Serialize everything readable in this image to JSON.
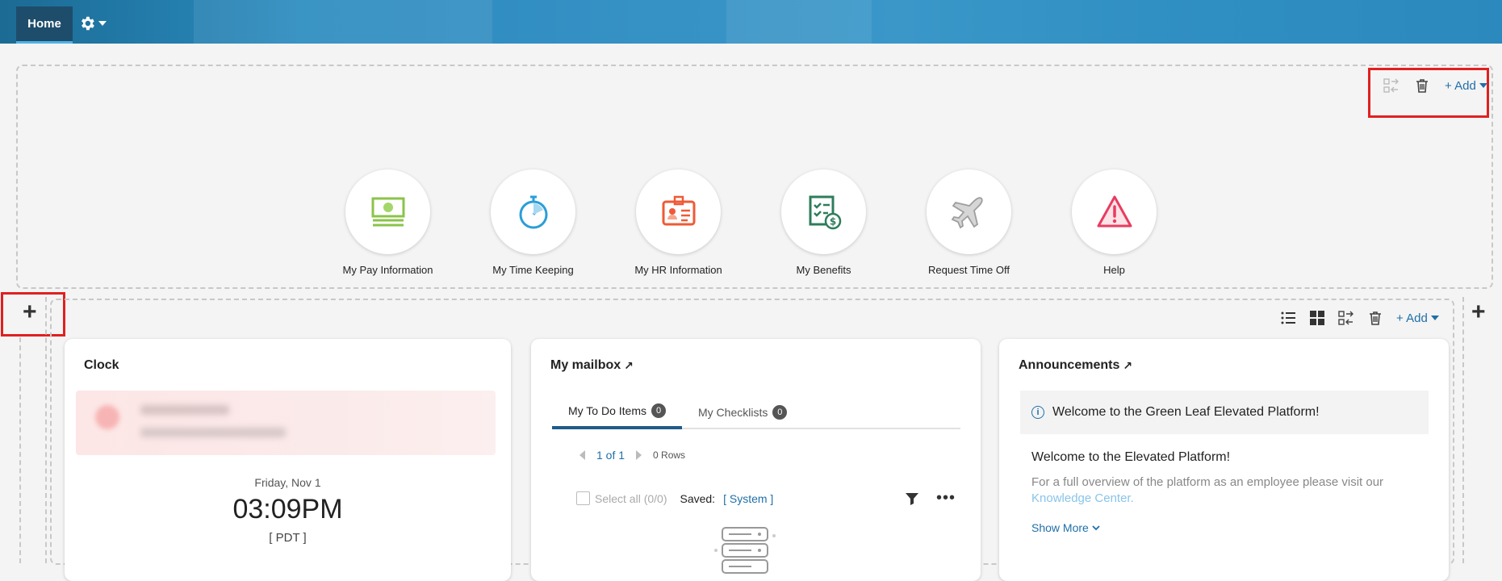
{
  "nav": {
    "home_tab": "Home"
  },
  "top_toolbar": {
    "add_label": "+ Add"
  },
  "quick_links": [
    {
      "label": "My Pay Information",
      "icon": "pay-icon"
    },
    {
      "label": "My Time Keeping",
      "icon": "stopwatch-icon"
    },
    {
      "label": "My HR Information",
      "icon": "id-badge-icon"
    },
    {
      "label": "My Benefits",
      "icon": "benefits-icon"
    },
    {
      "label": "Request Time Off",
      "icon": "airplane-icon"
    },
    {
      "label": "Help",
      "icon": "warning-icon"
    }
  ],
  "bottom_toolbar": {
    "add_label": "+ Add"
  },
  "clock": {
    "title": "Clock",
    "date": "Friday, Nov 1",
    "time": "03:09PM",
    "timezone": "[ PDT ]"
  },
  "mailbox": {
    "title": "My mailbox",
    "tabs": [
      {
        "label": "My To Do Items",
        "count": "0"
      },
      {
        "label": "My Checklists",
        "count": "0"
      }
    ],
    "pager": {
      "page": "1 of 1",
      "rows": "0 Rows"
    },
    "select_all": "Select all (0/0)",
    "saved_label": "Saved:",
    "saved_value": "[ System ]"
  },
  "announcements": {
    "title": "Announcements",
    "banner": "Welcome to the Green Leaf Elevated Platform!",
    "heading": "Welcome to the Elevated Platform!",
    "body": "For a full overview of the platform as an employee please visit our",
    "link": "Knowledge Center.",
    "show_more": "Show More"
  }
}
